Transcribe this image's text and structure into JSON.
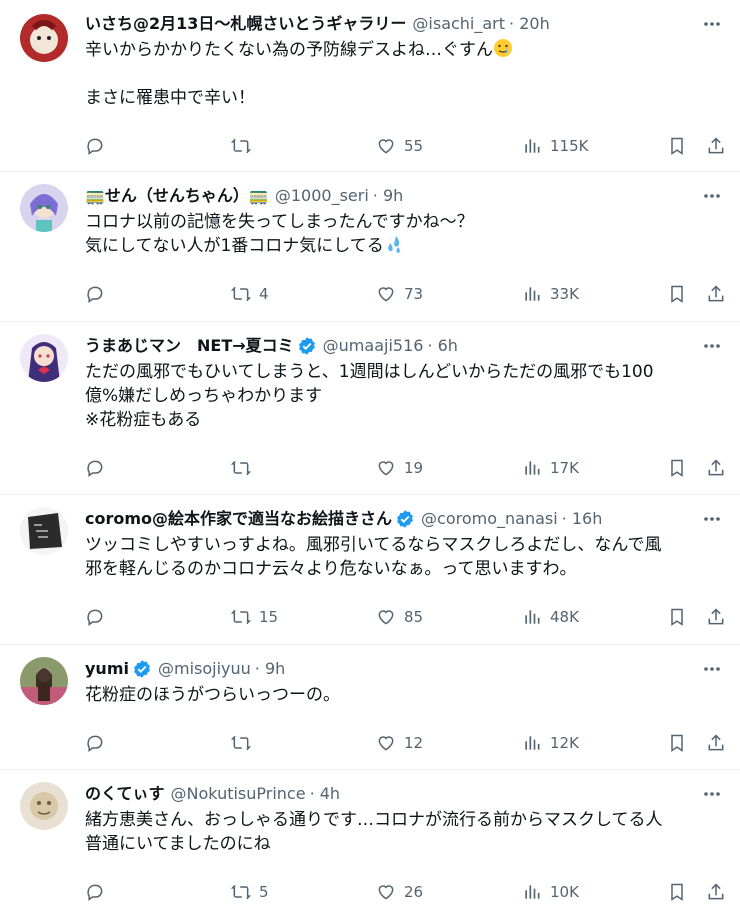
{
  "tweets": [
    {
      "name": "いさち@2月13日～札幌さいとうギャラリー",
      "handle": "@isachi_art",
      "time": "· 20h",
      "verified": false,
      "lines": [
        "辛いからかかりたくない為の予防線デスよね…ぐすん",
        "",
        "まさに罹患中で辛い！"
      ],
      "emoji": "crying-smile",
      "replies": "",
      "retweets": "",
      "likes": "55",
      "views": "115K",
      "avatar_color": "#c0392b"
    },
    {
      "name": "🚃せん（せんちゃん）🚃",
      "handle": "@1000_seri",
      "time": "· 9h",
      "verified": false,
      "lines": [
        "コロナ以前の記憶を失ってしまったんですかね〜？",
        "気にしてない人が1番コロナ気にしてる"
      ],
      "emoji": "sweat-drops",
      "replies": "",
      "retweets": "4",
      "likes": "73",
      "views": "33K",
      "avatar_color": "#7b6fd6"
    },
    {
      "name": "うまあじマン　NET→夏コミ",
      "handle": "@umaaji516",
      "time": "· 6h",
      "verified": true,
      "lines": [
        "ただの風邪でもひいてしまうと、1週間はしんどいからただの風邪でも100",
        "億%嫌だしめっちゃわかります",
        "※花粉症もある"
      ],
      "emoji": "",
      "replies": "",
      "retweets": "",
      "likes": "19",
      "views": "17K",
      "avatar_color": "#4a3f8a"
    },
    {
      "name": "coromo@絵本作家で適当なお絵描きさん",
      "handle": "@coromo_nanasi",
      "time": "· 16h",
      "verified": true,
      "lines": [
        "ツッコミしやすいっすよね。風邪引いてるならマスクしろよだし、なんで風",
        "邪を軽んじるのかコロナ云々より危ないなぁ。って思いますわ。"
      ],
      "emoji": "",
      "replies": "",
      "retweets": "15",
      "likes": "85",
      "views": "48K",
      "avatar_color": "#2b2b2b"
    },
    {
      "name": "yumi",
      "handle": "@misojiyuu",
      "time": "· 9h",
      "verified": true,
      "lines": [
        "花粉症のほうがつらいっつーの。"
      ],
      "emoji": "",
      "replies": "",
      "retweets": "",
      "likes": "12",
      "views": "12K",
      "avatar_color": "#8d5a4a"
    },
    {
      "name": "のくてぃす",
      "handle": "@NokutisuPrince",
      "time": "· 4h",
      "verified": false,
      "lines": [
        "緒方恵美さん、おっしゃる通りです…コロナが流行る前からマスクしてる人",
        "普通にいてましたのにね"
      ],
      "emoji": "",
      "replies": "",
      "retweets": "5",
      "likes": "26",
      "views": "10K",
      "avatar_color": "#c9b8a0"
    }
  ],
  "colors": {
    "text": "#0f1419",
    "muted": "#536471",
    "verified": "#1d9bf0",
    "divider": "#eff3f4"
  }
}
